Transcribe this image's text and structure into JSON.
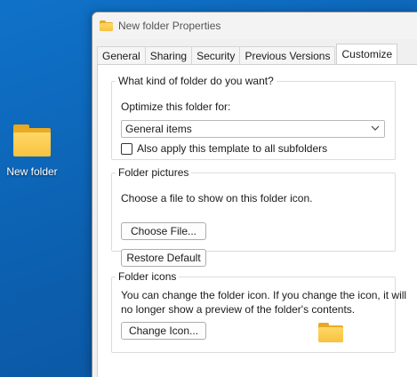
{
  "desktop": {
    "icon_label": "New folder"
  },
  "window": {
    "title": "New folder Properties",
    "tabs": [
      {
        "label": "General"
      },
      {
        "label": "Sharing"
      },
      {
        "label": "Security"
      },
      {
        "label": "Previous Versions"
      },
      {
        "label": "Customize",
        "active": true
      }
    ]
  },
  "customize": {
    "folder_type": {
      "legend": "What kind of folder do you want?",
      "optimize_label": "Optimize this folder for:",
      "selected_option": "General items",
      "checkbox_label": "Also apply this template to all subfolders",
      "checkbox_checked": false
    },
    "folder_pictures": {
      "legend": "Folder pictures",
      "description": "Choose a file to show on this folder icon.",
      "choose_button": "Choose File...",
      "restore_button": "Restore Default"
    },
    "folder_icons": {
      "legend": "Folder icons",
      "description_line1": "You can change the folder icon. If you change the icon, it will",
      "description_line2": "no longer show a preview of the folder's contents.",
      "change_button": "Change Icon..."
    }
  },
  "colors": {
    "desktop_bg": "#0c5fae",
    "folder_yellow": "#f7c240"
  }
}
